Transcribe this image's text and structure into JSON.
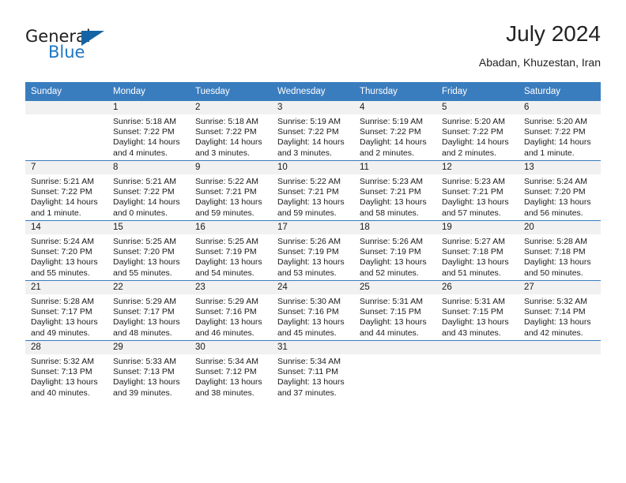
{
  "brand": {
    "name_part1": "General",
    "name_part2": "Blue",
    "triangle_icon": "triangle-icon",
    "accent_color": "#1f77c4",
    "header_color": "#3a7dbf"
  },
  "header": {
    "title": "July 2024",
    "subtitle": "Abadan, Khuzestan, Iran"
  },
  "weekdays": [
    "Sunday",
    "Monday",
    "Tuesday",
    "Wednesday",
    "Thursday",
    "Friday",
    "Saturday"
  ],
  "weeks": [
    [
      {
        "day": "",
        "lines": []
      },
      {
        "day": "1",
        "lines": [
          "Sunrise: 5:18 AM",
          "Sunset: 7:22 PM",
          "Daylight: 14 hours",
          "and 4 minutes."
        ]
      },
      {
        "day": "2",
        "lines": [
          "Sunrise: 5:18 AM",
          "Sunset: 7:22 PM",
          "Daylight: 14 hours",
          "and 3 minutes."
        ]
      },
      {
        "day": "3",
        "lines": [
          "Sunrise: 5:19 AM",
          "Sunset: 7:22 PM",
          "Daylight: 14 hours",
          "and 3 minutes."
        ]
      },
      {
        "day": "4",
        "lines": [
          "Sunrise: 5:19 AM",
          "Sunset: 7:22 PM",
          "Daylight: 14 hours",
          "and 2 minutes."
        ]
      },
      {
        "day": "5",
        "lines": [
          "Sunrise: 5:20 AM",
          "Sunset: 7:22 PM",
          "Daylight: 14 hours",
          "and 2 minutes."
        ]
      },
      {
        "day": "6",
        "lines": [
          "Sunrise: 5:20 AM",
          "Sunset: 7:22 PM",
          "Daylight: 14 hours",
          "and 1 minute."
        ]
      }
    ],
    [
      {
        "day": "7",
        "lines": [
          "Sunrise: 5:21 AM",
          "Sunset: 7:22 PM",
          "Daylight: 14 hours",
          "and 1 minute."
        ]
      },
      {
        "day": "8",
        "lines": [
          "Sunrise: 5:21 AM",
          "Sunset: 7:22 PM",
          "Daylight: 14 hours",
          "and 0 minutes."
        ]
      },
      {
        "day": "9",
        "lines": [
          "Sunrise: 5:22 AM",
          "Sunset: 7:21 PM",
          "Daylight: 13 hours",
          "and 59 minutes."
        ]
      },
      {
        "day": "10",
        "lines": [
          "Sunrise: 5:22 AM",
          "Sunset: 7:21 PM",
          "Daylight: 13 hours",
          "and 59 minutes."
        ]
      },
      {
        "day": "11",
        "lines": [
          "Sunrise: 5:23 AM",
          "Sunset: 7:21 PM",
          "Daylight: 13 hours",
          "and 58 minutes."
        ]
      },
      {
        "day": "12",
        "lines": [
          "Sunrise: 5:23 AM",
          "Sunset: 7:21 PM",
          "Daylight: 13 hours",
          "and 57 minutes."
        ]
      },
      {
        "day": "13",
        "lines": [
          "Sunrise: 5:24 AM",
          "Sunset: 7:20 PM",
          "Daylight: 13 hours",
          "and 56 minutes."
        ]
      }
    ],
    [
      {
        "day": "14",
        "lines": [
          "Sunrise: 5:24 AM",
          "Sunset: 7:20 PM",
          "Daylight: 13 hours",
          "and 55 minutes."
        ]
      },
      {
        "day": "15",
        "lines": [
          "Sunrise: 5:25 AM",
          "Sunset: 7:20 PM",
          "Daylight: 13 hours",
          "and 55 minutes."
        ]
      },
      {
        "day": "16",
        "lines": [
          "Sunrise: 5:25 AM",
          "Sunset: 7:19 PM",
          "Daylight: 13 hours",
          "and 54 minutes."
        ]
      },
      {
        "day": "17",
        "lines": [
          "Sunrise: 5:26 AM",
          "Sunset: 7:19 PM",
          "Daylight: 13 hours",
          "and 53 minutes."
        ]
      },
      {
        "day": "18",
        "lines": [
          "Sunrise: 5:26 AM",
          "Sunset: 7:19 PM",
          "Daylight: 13 hours",
          "and 52 minutes."
        ]
      },
      {
        "day": "19",
        "lines": [
          "Sunrise: 5:27 AM",
          "Sunset: 7:18 PM",
          "Daylight: 13 hours",
          "and 51 minutes."
        ]
      },
      {
        "day": "20",
        "lines": [
          "Sunrise: 5:28 AM",
          "Sunset: 7:18 PM",
          "Daylight: 13 hours",
          "and 50 minutes."
        ]
      }
    ],
    [
      {
        "day": "21",
        "lines": [
          "Sunrise: 5:28 AM",
          "Sunset: 7:17 PM",
          "Daylight: 13 hours",
          "and 49 minutes."
        ]
      },
      {
        "day": "22",
        "lines": [
          "Sunrise: 5:29 AM",
          "Sunset: 7:17 PM",
          "Daylight: 13 hours",
          "and 48 minutes."
        ]
      },
      {
        "day": "23",
        "lines": [
          "Sunrise: 5:29 AM",
          "Sunset: 7:16 PM",
          "Daylight: 13 hours",
          "and 46 minutes."
        ]
      },
      {
        "day": "24",
        "lines": [
          "Sunrise: 5:30 AM",
          "Sunset: 7:16 PM",
          "Daylight: 13 hours",
          "and 45 minutes."
        ]
      },
      {
        "day": "25",
        "lines": [
          "Sunrise: 5:31 AM",
          "Sunset: 7:15 PM",
          "Daylight: 13 hours",
          "and 44 minutes."
        ]
      },
      {
        "day": "26",
        "lines": [
          "Sunrise: 5:31 AM",
          "Sunset: 7:15 PM",
          "Daylight: 13 hours",
          "and 43 minutes."
        ]
      },
      {
        "day": "27",
        "lines": [
          "Sunrise: 5:32 AM",
          "Sunset: 7:14 PM",
          "Daylight: 13 hours",
          "and 42 minutes."
        ]
      }
    ],
    [
      {
        "day": "28",
        "lines": [
          "Sunrise: 5:32 AM",
          "Sunset: 7:13 PM",
          "Daylight: 13 hours",
          "and 40 minutes."
        ]
      },
      {
        "day": "29",
        "lines": [
          "Sunrise: 5:33 AM",
          "Sunset: 7:13 PM",
          "Daylight: 13 hours",
          "and 39 minutes."
        ]
      },
      {
        "day": "30",
        "lines": [
          "Sunrise: 5:34 AM",
          "Sunset: 7:12 PM",
          "Daylight: 13 hours",
          "and 38 minutes."
        ]
      },
      {
        "day": "31",
        "lines": [
          "Sunrise: 5:34 AM",
          "Sunset: 7:11 PM",
          "Daylight: 13 hours",
          "and 37 minutes."
        ]
      },
      {
        "day": "",
        "lines": []
      },
      {
        "day": "",
        "lines": []
      },
      {
        "day": "",
        "lines": []
      }
    ]
  ]
}
